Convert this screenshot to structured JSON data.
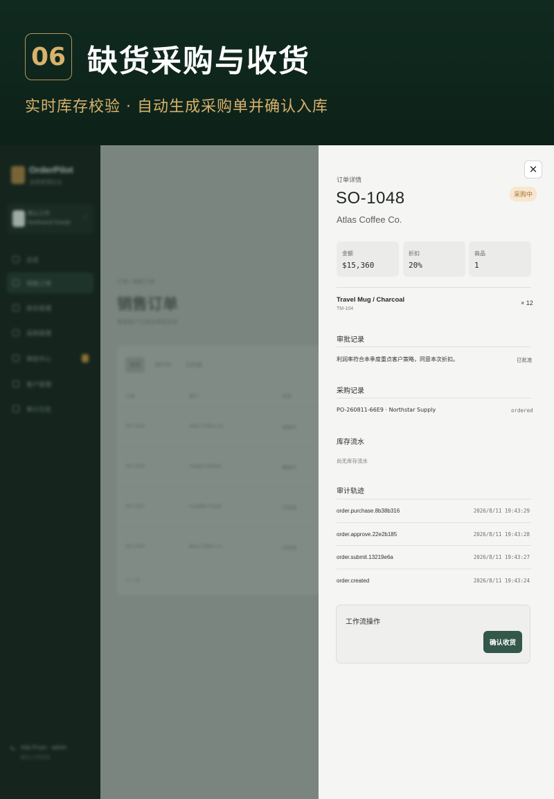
{
  "banner": {
    "step": "06",
    "title": "缺货采购与收货",
    "subtitle": "实时库存校验 · 自动生成采购单并确认入库"
  },
  "sidebar": {
    "brand": "OrderPilot",
    "brand_sub": "运营管理后台",
    "workspace_name": "默认工作",
    "workspace_org": "Northwind Goods",
    "nav": [
      "总览",
      "销售订单",
      "库存管理",
      "采购管理",
      "审批中心",
      "客户管理",
      "审计日志"
    ],
    "user_name": "Ada Pruyn · admin",
    "user_role": "默认工作空间"
  },
  "main": {
    "breadcrumb": "订单 / 销售订单",
    "title": "销售订单",
    "subtitle": "查看客户订单及审批状态",
    "tabs": [
      "全部",
      "进行中",
      "已完成"
    ],
    "columns": [
      "订单",
      "客户",
      "状态"
    ],
    "rows": [
      [
        "SO-1048",
        "Atlas Coffee Co.",
        "采购中"
      ],
      [
        "SO-1046",
        "Juniper Market",
        "审批中"
      ],
      [
        "SO-1047",
        "Candlfer Foods",
        "已完成"
      ],
      [
        "SO-1045",
        "Blue Coffee Co.",
        "已完成"
      ]
    ],
    "footer": "共 4 条"
  },
  "drawer": {
    "eyebrow": "订单详情",
    "order_id": "SO-1048",
    "status": "采购中",
    "customer": "Atlas Coffee Co.",
    "stats": [
      {
        "label": "金额",
        "value": "$15,360"
      },
      {
        "label": "折扣",
        "value": "20%"
      },
      {
        "label": "商品",
        "value": "1"
      }
    ],
    "item": {
      "name": "Travel Mug / Charcoal",
      "sku": "TM-104",
      "qty": "× 12"
    },
    "approval": {
      "title": "审批记录",
      "text": "利润率符合本季度重点客户策略，同意本次折扣。",
      "status": "已批准"
    },
    "purchase": {
      "title": "采购记录",
      "text": "PO-260811-66E9 · Northstar Supply",
      "status": "ordered"
    },
    "stock": {
      "title": "库存流水",
      "empty": "尚无库存流水"
    },
    "audit": {
      "title": "审计轨迹",
      "rows": [
        {
          "event": "order.purchase.8b38b316",
          "time": "2026/8/11 19:43:29"
        },
        {
          "event": "order.approve.22e2b185",
          "time": "2026/8/11 19:43:28"
        },
        {
          "event": "order.submit.13219e6a",
          "time": "2026/8/11 19:43:27"
        },
        {
          "event": "order.created",
          "time": "2026/8/11 19:43:24"
        }
      ]
    },
    "workflow": {
      "title": "工作流操作",
      "button": "确认收货"
    }
  }
}
